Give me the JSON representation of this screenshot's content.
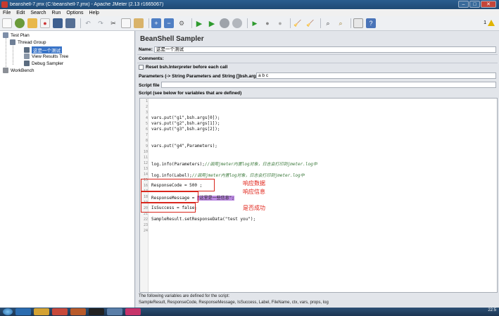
{
  "window": {
    "title": "beanshell-7.jmx (C:\\beanshell-7.jmx) - Apache JMeter (2.13 r1665067)"
  },
  "menu": [
    "File",
    "Edit",
    "Search",
    "Run",
    "Options",
    "Help"
  ],
  "toolbar": {
    "icons": [
      "new-icon",
      "templates-icon",
      "open-icon",
      "close-icon",
      "save-icon",
      "save-as-icon",
      "undo-icon",
      "redo-icon",
      "cut-icon",
      "copy-icon",
      "paste-icon",
      "add-icon",
      "remove-icon",
      "toggle-icon",
      "start-icon",
      "start-no-pause-icon",
      "stop-icon",
      "shutdown-icon",
      "remote-start-icon",
      "remote-stop-icon",
      "remote-shutdown-icon",
      "clear-icon",
      "clear-all-icon",
      "search-icon",
      "reset-search-icon",
      "function-helper-icon",
      "help-icon"
    ],
    "warning_count": "1"
  },
  "tree": {
    "test_plan": "Test Plan",
    "thread_group": "Thread Group",
    "selected_sampler": "这是一个测试",
    "view_results": "View Results Tree",
    "debug_sampler": "Debug Sampler",
    "workbench": "WorkBench"
  },
  "panel": {
    "title": "BeanShell Sampler",
    "name_label": "Name:",
    "name_value": "这是一个测试",
    "comments_label": "Comments:",
    "reset_label": "Reset bsh.Interpreter before each call",
    "params_label": "Parameters (-> String Parameters and String []bsh.args)",
    "params_value": "a b c",
    "script_file_label": "Script file",
    "script_label": "Script (see below for variables that are defined)"
  },
  "script": {
    "line_numbers": [
      "1",
      "2",
      "3",
      "4",
      "5",
      "6",
      "7",
      "8",
      "9",
      "10",
      "11",
      "12",
      "13",
      "14",
      "15",
      "16",
      "17",
      "18",
      "19",
      "20",
      "21",
      "22",
      "23",
      "24"
    ],
    "line4": "vars.put(\"g1\",bsh.args[0]);",
    "line5": "vars.put(\"g2\",bsh.args[1]);",
    "line6": "vars.put(\"g3\",bsh.args[2]);",
    "line9": "vars.put(\"g4\",Parameters);",
    "line12_code": "log.info(Parameters);",
    "line12_comment": "//调用jmeter内置log对象，日志会打印到jmeter.log中",
    "line14_code": "log.info(Label);",
    "line14_comment": "//调用jmeter内置log对象，日志会打印到jmeter.log中",
    "line16": "ResponseCode = 500 ;",
    "line18_code": "ResponseMessage = ",
    "line18_string": "\"这里是一些信息\";",
    "line20": "IsSuccess = false;",
    "line22": "SampleResult.setResponseData(\"test you\");"
  },
  "annotations": {
    "response_data": "响应数据",
    "response_info": "响应信息",
    "success": "是否成功"
  },
  "footer": {
    "line1": "The following variables are defined for the script:",
    "line2": "SampleResult, ResponseCode, ResponseMessage, IsSuccess, Label, FileName, ctx, vars, props, log"
  },
  "taskbar": {
    "clock": "22:5"
  }
}
